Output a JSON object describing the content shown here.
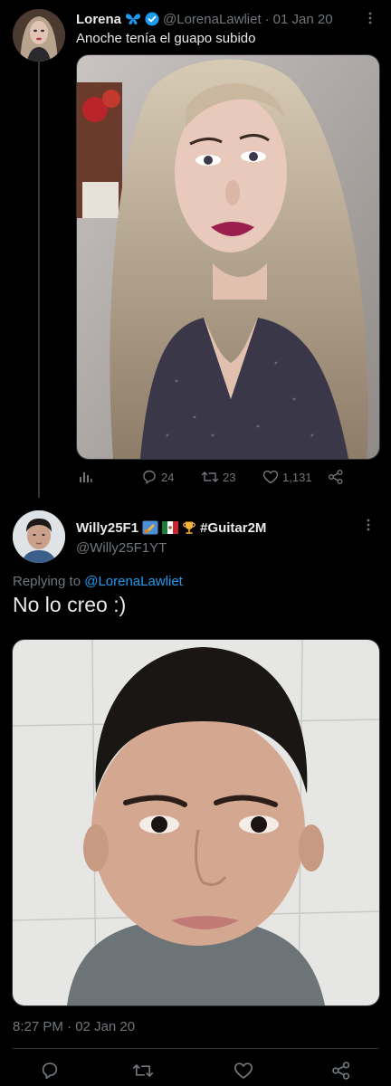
{
  "tweet1": {
    "author_name": "Lorena",
    "butterfly_emoji": "🦋",
    "handle": "@LorenaLawliet",
    "date": "01 Jan 20",
    "separator": "·",
    "text": "Anoche tenía el guapo subido",
    "metrics": {
      "replies": "24",
      "retweets": "23",
      "likes": "1,131"
    }
  },
  "tweet2": {
    "author_name": "Willy25F1",
    "badge_text": "#Guitar2M",
    "handle": "@Willy25F1YT",
    "replying_prefix": "Replying to ",
    "replying_to": "@LorenaLawliet",
    "text": "No lo creo :)",
    "time": "8:27 PM",
    "date": "02 Jan 20",
    "separator": "·"
  },
  "colors": {
    "background": "#000000",
    "text_primary": "#e7e9ea",
    "text_secondary": "#71767b",
    "accent": "#1d9bf0",
    "border": "#2f3336"
  },
  "icons": {
    "more": "more-horizontal-icon",
    "verified": "verified-badge-icon",
    "analytics": "analytics-icon",
    "reply": "reply-icon",
    "retweet": "retweet-icon",
    "like": "heart-icon",
    "share": "share-icon"
  }
}
